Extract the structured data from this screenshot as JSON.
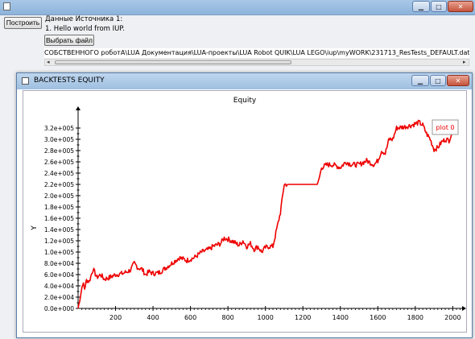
{
  "outer": {
    "build_button": "Построить",
    "source_header": "Данные Источника 1:",
    "hello_line": "1. Hello world from IUP.",
    "choose_file_button": "Выбрать файл",
    "file_path": "СОБСТВЕННОГО роботА\\LUA Документация\\LUA-проекты\\LUA Robot QUIK\\LUA LEGO\\iup\\myWORK\\231713_ResTests_DEFAULT.dat"
  },
  "front": {
    "title": "BACKTESTS EQUITY"
  },
  "colors": {
    "series": "#ee0000",
    "titlebar": "#a9c8e8",
    "close": "#c5533d"
  },
  "chart_data": {
    "type": "line",
    "title": "Equity",
    "xlabel": "",
    "ylabel": "Y",
    "xlim": [
      0,
      2050
    ],
    "ylim": [
      0,
      340000
    ],
    "x_ticks": [
      200,
      400,
      600,
      800,
      1000,
      1200,
      1400,
      1600,
      1800,
      2000
    ],
    "y_ticks": [
      0,
      20000,
      40000,
      60000,
      80000,
      100000,
      120000,
      140000,
      160000,
      180000,
      200000,
      220000,
      240000,
      260000,
      280000,
      300000,
      320000
    ],
    "y_tick_labels": [
      "0.0e+000",
      "2.0e+004",
      "4.0e+004",
      "6.0e+004",
      "8.0e+004",
      "1.0e+005",
      "1.2e+005",
      "1.4e+005",
      "1.6e+005",
      "1.8e+005",
      "2.0e+005",
      "2.2e+005",
      "2.4e+005",
      "2.6e+005",
      "2.8e+005",
      "3.0e+005",
      "3.2e+005"
    ],
    "legend": "plot 0",
    "legend_position": "top-right",
    "series": [
      {
        "name": "plot 0",
        "color": "#ee0000",
        "x": [
          0,
          25,
          35,
          45,
          60,
          80,
          100,
          120,
          140,
          170,
          200,
          240,
          280,
          300,
          320,
          340,
          360,
          380,
          400,
          430,
          460,
          500,
          540,
          580,
          620,
          660,
          700,
          720,
          760,
          780,
          800,
          830,
          860,
          880,
          900,
          920,
          940,
          960,
          980,
          1000,
          1020,
          1040,
          1060,
          1080,
          1100,
          1120,
          1150,
          1200,
          1250,
          1280,
          1300,
          1330,
          1360,
          1400,
          1430,
          1460,
          1500,
          1540,
          1580,
          1600,
          1620,
          1640,
          1660,
          1680,
          1700,
          1740,
          1780,
          1820,
          1840,
          1860,
          1880,
          1900,
          1920,
          1940,
          1960,
          1980,
          2000
        ],
        "y": [
          0,
          45000,
          35000,
          50000,
          48000,
          70000,
          55000,
          60000,
          52000,
          55000,
          60000,
          62000,
          68000,
          80000,
          72000,
          70000,
          60000,
          65000,
          62000,
          63000,
          70000,
          80000,
          90000,
          85000,
          90000,
          100000,
          105000,
          110000,
          115000,
          125000,
          123000,
          118000,
          112000,
          120000,
          110000,
          115000,
          105000,
          110000,
          100000,
          108000,
          110000,
          110000,
          140000,
          170000,
          220000,
          220000,
          220000,
          220000,
          220000,
          220000,
          250000,
          255000,
          255000,
          250000,
          260000,
          255000,
          255000,
          262000,
          255000,
          262000,
          280000,
          275000,
          300000,
          300000,
          320000,
          322000,
          325000,
          330000,
          325000,
          310000,
          300000,
          282000,
          285000,
          295000,
          300000,
          298000,
          315000
        ]
      }
    ]
  }
}
